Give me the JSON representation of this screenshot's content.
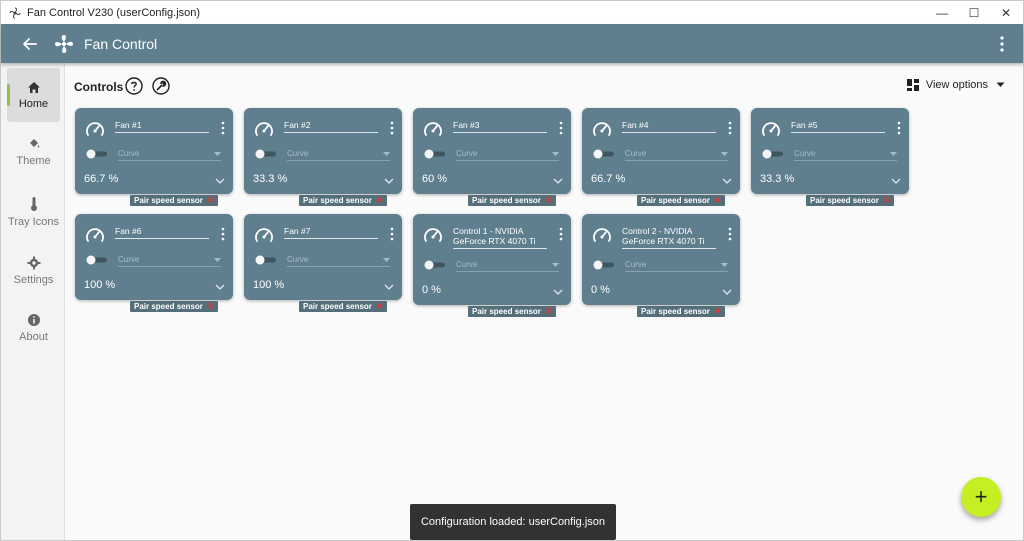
{
  "window": {
    "title": "Fan Control V230 (userConfig.json)",
    "minimize": "—",
    "maximize": "☐",
    "close": "✕"
  },
  "appbar": {
    "title": "Fan Control"
  },
  "sidebar": {
    "items": [
      {
        "label": "Home",
        "icon": "home-icon",
        "active": true
      },
      {
        "label": "Theme",
        "icon": "paint-bucket-icon"
      },
      {
        "label": "Tray Icons",
        "icon": "thermometer-icon"
      },
      {
        "label": "Settings",
        "icon": "gear-icon"
      },
      {
        "label": "About",
        "icon": "info-icon"
      }
    ]
  },
  "main": {
    "title": "Controls",
    "view_options": "View options",
    "cards": [
      {
        "name": "Fan #1",
        "curve": "Curve",
        "percent": "66.7 %",
        "pair": "Pair speed sensor"
      },
      {
        "name": "Fan #2",
        "curve": "Curve",
        "percent": "33.3 %",
        "pair": "Pair speed sensor"
      },
      {
        "name": "Fan #3",
        "curve": "Curve",
        "percent": "60 %",
        "pair": "Pair speed sensor"
      },
      {
        "name": "Fan #4",
        "curve": "Curve",
        "percent": "66.7 %",
        "pair": "Pair speed sensor"
      },
      {
        "name": "Fan #5",
        "curve": "Curve",
        "percent": "33.3 %",
        "pair": "Pair speed sensor"
      },
      {
        "name": "Fan #6",
        "curve": "Curve",
        "percent": "100 %",
        "pair": "Pair speed sensor"
      },
      {
        "name": "Fan #7",
        "curve": "Curve",
        "percent": "100 %",
        "pair": "Pair speed sensor"
      },
      {
        "name": "Control 1 - NVIDIA GeForce RTX 4070 Ti",
        "curve": "Curve",
        "percent": "0 %",
        "pair": "Pair speed sensor"
      },
      {
        "name": "Control 2 - NVIDIA GeForce RTX 4070 Ti",
        "curve": "Curve",
        "percent": "0 %",
        "pair": "Pair speed sensor"
      }
    ]
  },
  "toast": {
    "message": "Configuration loaded: userConfig.json"
  },
  "fab": {
    "label": "+"
  },
  "colors": {
    "appbar": "#5f7f8f",
    "card": "#5f7f8f",
    "accent": "#c6ef23",
    "active_indicator": "#8bc34a"
  }
}
